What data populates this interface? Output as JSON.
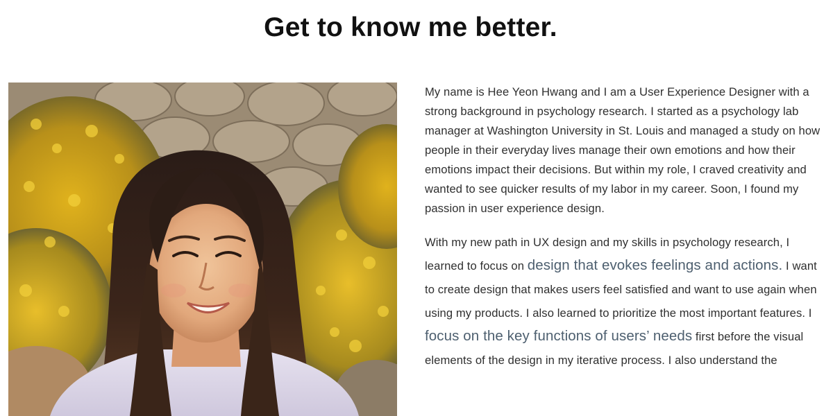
{
  "header": {
    "title": "Get to know me better."
  },
  "photo": {
    "alt": "Portrait photo"
  },
  "bio": {
    "p1": "My name is Hee Yeon Hwang and I am a User Experience Designer with a strong background in psychology research. I started as a psychology lab manager at Washington University in St. Louis and managed a study on how people in their everyday lives manage their own emotions and how their emotions impact their decisions. But within my role, I craved creativity and wanted to see quicker results of my labor in my career. Soon, I found my passion in user experience design.",
    "p2": {
      "t1": "With my new path in UX design and my skills in psychology research, I learned to focus on ",
      "h1": "design that evokes feelings and actions.",
      "t2": " I want to create design that makes users feel satisfied and want to use again when using my products. I also learned to prioritize the most important features. I ",
      "h2": "focus on the key functions of users’ needs",
      "t3": " first before the visual elements of the design in my iterative process. I also understand the"
    }
  },
  "colors": {
    "text": "#2f2f2f",
    "highlight": "#4d5f6f",
    "title": "#111111",
    "background": "#ffffff"
  }
}
